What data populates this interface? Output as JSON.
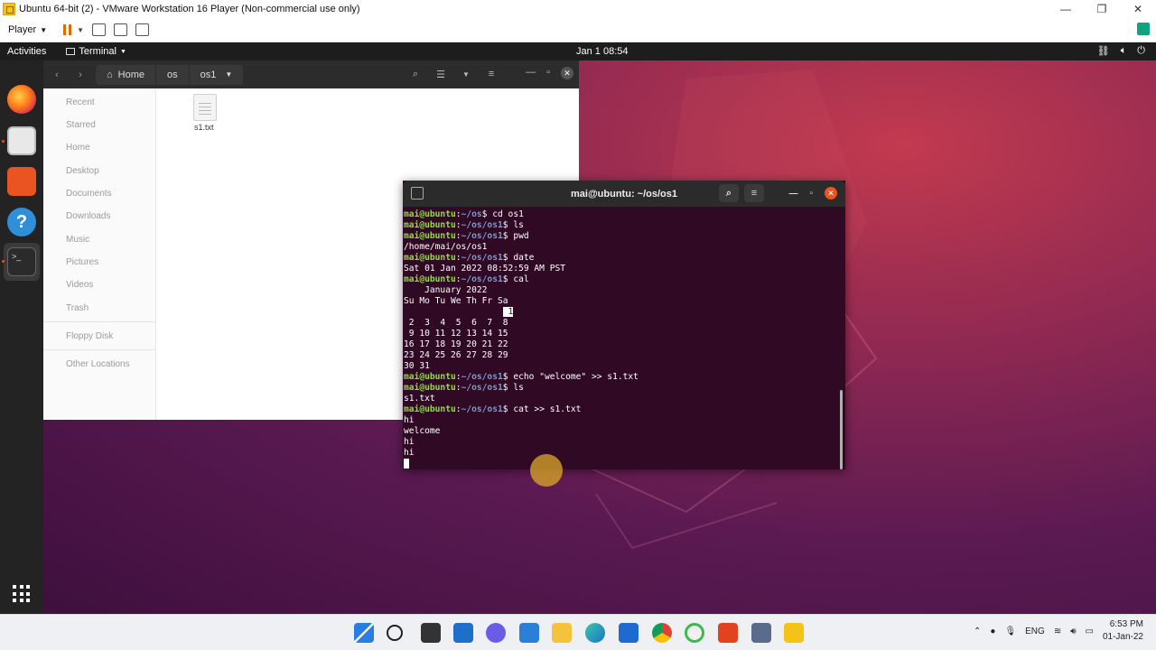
{
  "host": {
    "window_title": "Ubuntu 64-bit (2) - VMware Workstation 16 Player (Non-commercial use only)",
    "player_menu": "Player",
    "controls": {
      "minimize": "—",
      "restore": "❐",
      "close": "✕"
    }
  },
  "ubuntu_topbar": {
    "activities": "Activities",
    "app_menu": "Terminal",
    "clock": "Jan 1  08:54",
    "tray_icons": [
      "network-icon",
      "volume-icon",
      "power-icon"
    ]
  },
  "files": {
    "path": [
      "Home",
      "os",
      "os1"
    ],
    "sidebar": [
      "Recent",
      "Starred",
      "Home",
      "Desktop",
      "Documents",
      "Downloads",
      "Music",
      "Pictures",
      "Videos",
      "Trash",
      "Floppy Disk",
      "Other Locations"
    ],
    "file_name": "s1.txt"
  },
  "terminal": {
    "title": "mai@ubuntu: ~/os/os1",
    "lines": [
      {
        "user": "mai@ubuntu",
        "path": "~/os",
        "cmd": "cd os1"
      },
      {
        "user": "mai@ubuntu",
        "path": "~/os/os1",
        "cmd": "ls"
      },
      {
        "user": "mai@ubuntu",
        "path": "~/os/os1",
        "cmd": "pwd"
      },
      {
        "out": "/home/mai/os/os1"
      },
      {
        "user": "mai@ubuntu",
        "path": "~/os/os1",
        "cmd": "date"
      },
      {
        "out": "Sat 01 Jan 2022 08:52:59 AM PST"
      },
      {
        "user": "mai@ubuntu",
        "path": "~/os/os1",
        "cmd": "cal"
      },
      {
        "out": "    January 2022"
      },
      {
        "out": "Su Mo Tu We Th Fr Sa"
      },
      {
        "out": "                   ",
        "hl": " 1"
      },
      {
        "out": " 2  3  4  5  6  7  8"
      },
      {
        "out": " 9 10 11 12 13 14 15"
      },
      {
        "out": "16 17 18 19 20 21 22"
      },
      {
        "out": "23 24 25 26 27 28 29"
      },
      {
        "out": "30 31"
      },
      {
        "user": "mai@ubuntu",
        "path": "~/os/os1",
        "cmd": "echo \"welcome\" >> s1.txt"
      },
      {
        "user": "mai@ubuntu",
        "path": "~/os/os1",
        "cmd": "ls"
      },
      {
        "out": "s1.txt"
      },
      {
        "user": "mai@ubuntu",
        "path": "~/os/os1",
        "cmd": "cat >> s1.txt"
      },
      {
        "out": "hi"
      },
      {
        "out": "welcome"
      },
      {
        "out": "hi"
      },
      {
        "out": "hi"
      },
      {
        "cursor": true
      }
    ]
  },
  "taskbar": {
    "language": "ENG",
    "time": "6:53 PM",
    "date": "01-Jan-22",
    "apps": [
      "start-icon",
      "search-icon",
      "task-view-icon",
      "widgets-icon",
      "chat-icon",
      "store-icon",
      "file-explorer-icon",
      "edge-icon",
      "mail-icon",
      "chrome-icon",
      "app-icon",
      "office-icon",
      "security-icon",
      "vmware-icon"
    ]
  },
  "colors": {
    "ubuntu_orange": "#e95420",
    "terminal_bg": "#300a24",
    "prompt_user": "#8ae234",
    "prompt_path": "#729fcf"
  }
}
